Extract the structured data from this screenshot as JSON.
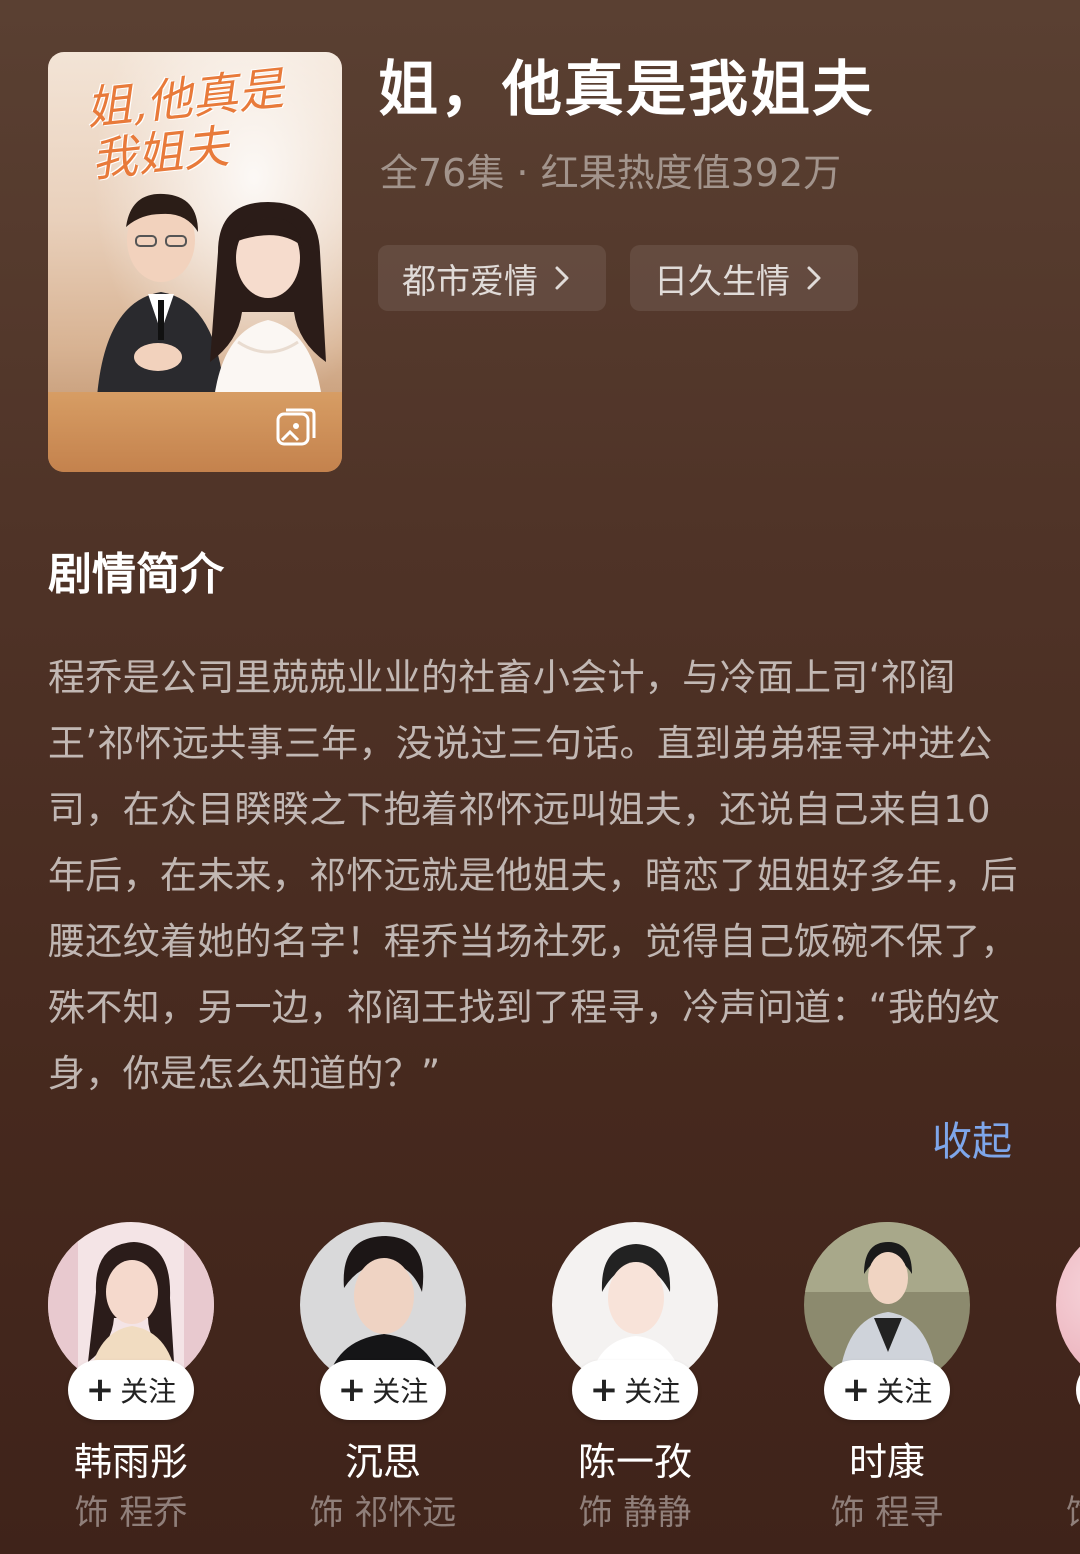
{
  "drama": {
    "title": "姐，他真是我姐夫",
    "meta": "全76集 · 红果热度值392万",
    "poster_title": "姐,他真是我姐夫",
    "tags": [
      {
        "label": "都市爱情"
      },
      {
        "label": "日久生情"
      }
    ]
  },
  "synopsis": {
    "heading": "剧情简介",
    "text": "程乔是公司里兢兢业业的社畜小会计，与冷面上司‘祁阎王’祁怀远共事三年，没说过三句话。直到弟弟程寻冲进公司，在众目睽睽之下抱着祁怀远叫姐夫，还说自己来自10年后，在未来，祁怀远就是他姐夫，暗恋了姐姐好多年，后腰还纹着她的名字！程乔当场社死，觉得自己饭碗不保了，殊不知，另一边，祁阎王找到了程寻，冷声问道：“我的纹身，你是怎么知道的？”",
    "collapse_label": "收起"
  },
  "cast": {
    "follow_label": "关注",
    "members": [
      {
        "name": "韩雨彤",
        "role": "饰 程乔"
      },
      {
        "name": "沉思",
        "role": "饰 祁怀远"
      },
      {
        "name": "陈一孜",
        "role": "饰 静静"
      },
      {
        "name": "时康",
        "role": "饰 程寻"
      }
    ],
    "partial_role": "饰"
  },
  "colors": {
    "background_top": "#5a4032",
    "background_bottom": "#3f231a",
    "link": "#7ea6ea",
    "poster_title": "#e87a3a"
  }
}
